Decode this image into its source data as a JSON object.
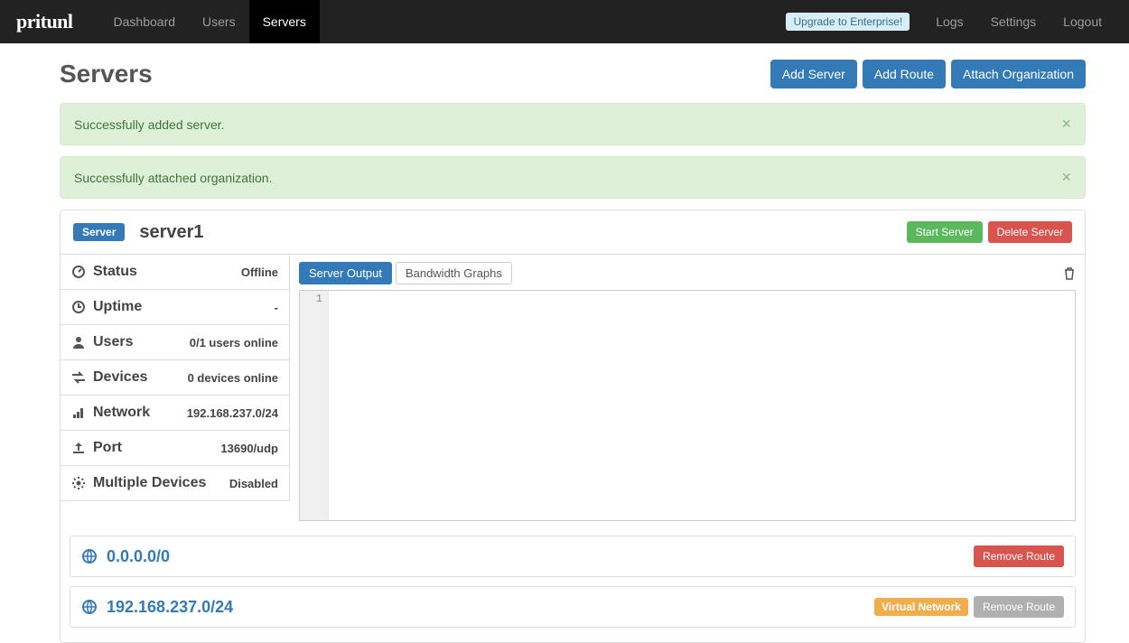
{
  "brand": "pritunl",
  "nav": {
    "left": [
      "Dashboard",
      "Users",
      "Servers"
    ],
    "active_index": 2,
    "upgrade": "Upgrade to Enterprise!",
    "right": [
      "Logs",
      "Settings",
      "Logout"
    ]
  },
  "header": {
    "title": "Servers",
    "buttons": {
      "add_server": "Add Server",
      "add_route": "Add Route",
      "attach_org": "Attach Organization"
    }
  },
  "alerts": [
    "Successfully added server.",
    "Successfully attached organization."
  ],
  "server": {
    "tag": "Server",
    "name": "server1",
    "buttons": {
      "start": "Start Server",
      "delete": "Delete Server"
    },
    "stats": {
      "status": {
        "label": "Status",
        "value": "Offline"
      },
      "uptime": {
        "label": "Uptime",
        "value": "-"
      },
      "users": {
        "label": "Users",
        "value": "0/1 users online"
      },
      "devices": {
        "label": "Devices",
        "value": "0 devices online"
      },
      "network": {
        "label": "Network",
        "value": "192.168.237.0/24"
      },
      "port": {
        "label": "Port",
        "value": "13690/udp"
      },
      "multidev": {
        "label": "Multiple Devices",
        "value": "Disabled"
      }
    },
    "tabs": {
      "output": "Server Output",
      "bandwidth": "Bandwidth Graphs"
    },
    "console_line_no": "1"
  },
  "routes": [
    {
      "cidr": "0.0.0.0/0",
      "virtual": false,
      "remove": "Remove Route"
    },
    {
      "cidr": "192.168.237.0/24",
      "virtual": true,
      "remove": "Remove Route",
      "virtual_label": "Virtual Network"
    }
  ]
}
